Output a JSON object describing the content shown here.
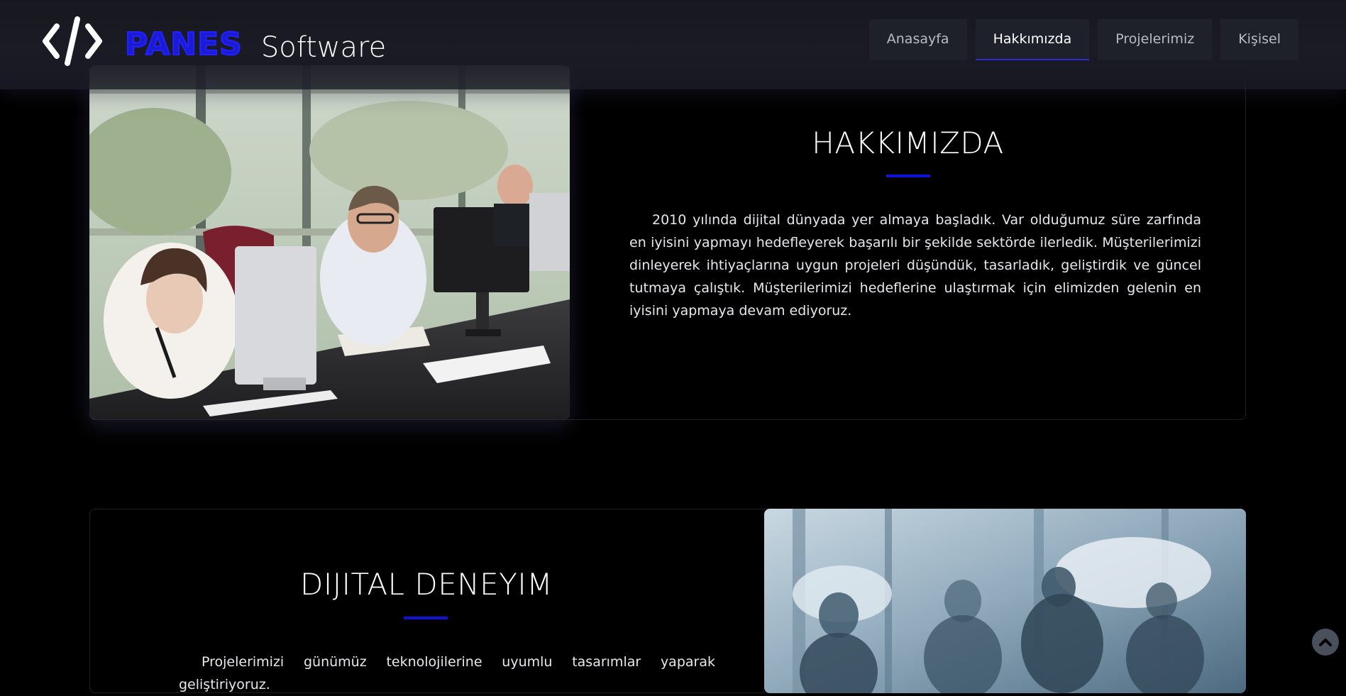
{
  "header": {
    "brand_name": "PANES",
    "brand_suffix": "Software",
    "nav": [
      {
        "label": "Anasayfa"
      },
      {
        "label": "Hakkımızda"
      },
      {
        "label": "Projelerimiz"
      },
      {
        "label": "Kişisel"
      }
    ],
    "active_nav": "Hakkımızda"
  },
  "about": {
    "title": "HAKKIMIZDA",
    "text": "2010 yılında dijital dünyada yer almaya başladık. Var olduğumuz süre zarfında en iyisini yapmayı hedefleyerek başarılı bir şekilde sektörde ilerledik. Müşterilerimizi dinleyerek ihtiyaçlarına uygun projeleri düşündük, tasarladık, geliştirdik ve güncel tutmaya çalıştık. Müşterilerimizi hedeflerine ulaştırmak için elimizden gelenin en iyisini yapmaya devam ediyoruz."
  },
  "digital": {
    "title": "DIJITAL DENEYIM",
    "text": "Projelerimizi günümüz teknolojilerine uyumlu tasarımlar yaparak geliştiriyoruz."
  },
  "colors": {
    "accent": "#1111dd",
    "background": "#000000",
    "nav_bg": "#1e2129"
  },
  "icons": {
    "brand": "code-icon",
    "scroll_top": "chevron-up-icon"
  }
}
